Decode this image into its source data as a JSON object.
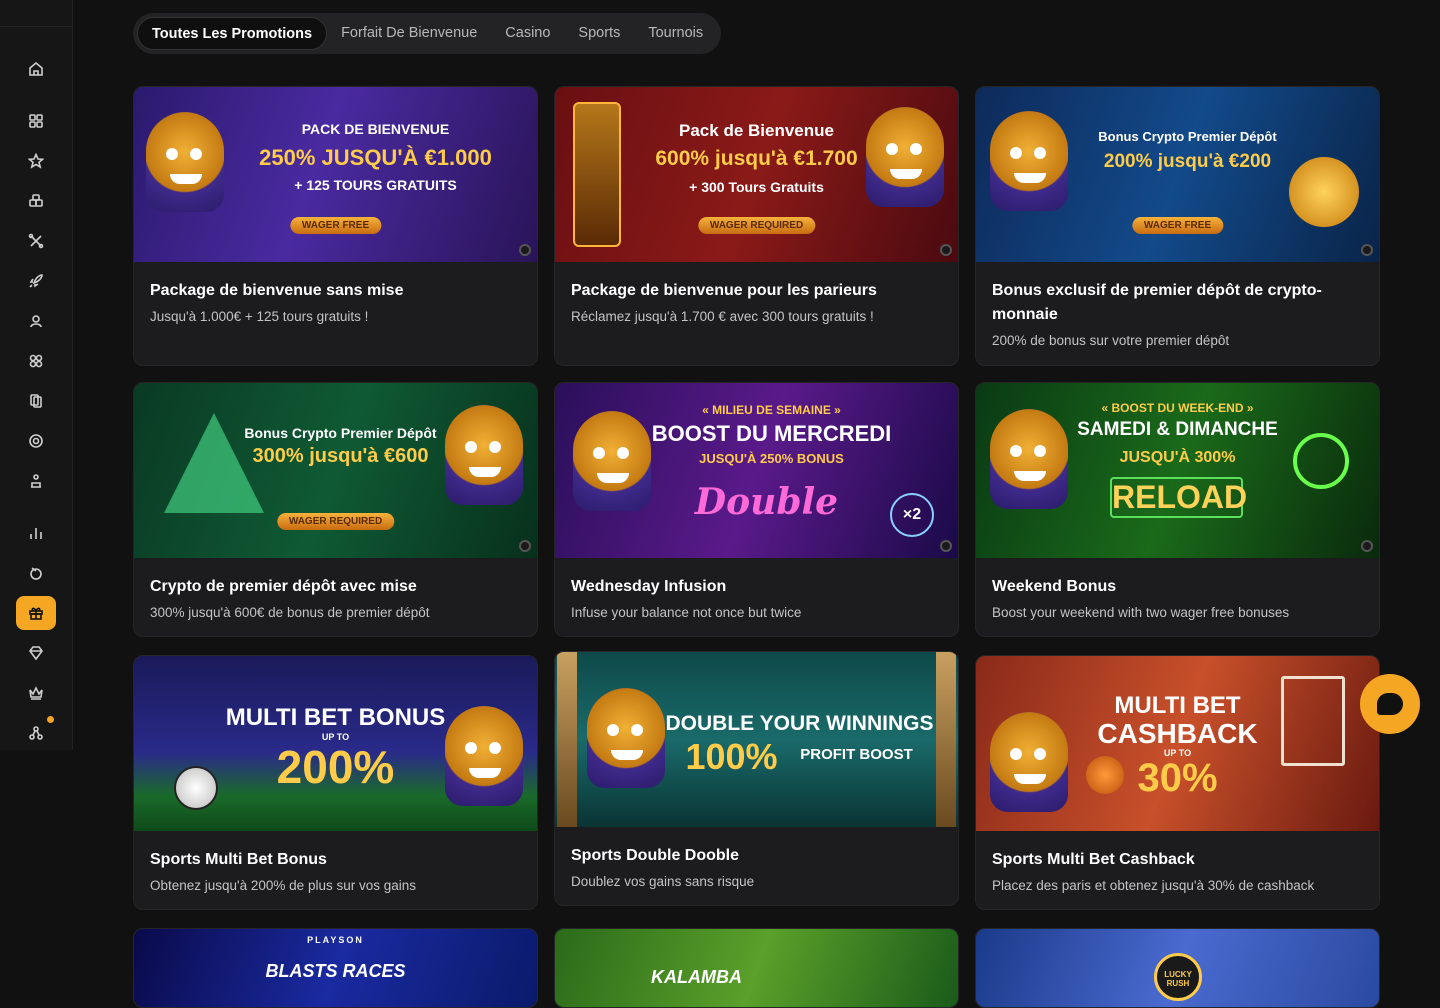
{
  "nav_tabs": [
    {
      "label": "Toutes Les Promotions",
      "active": true
    },
    {
      "label": "Forfait De Bienvenue",
      "active": false
    },
    {
      "label": "Casino",
      "active": false
    },
    {
      "label": "Sports",
      "active": false
    },
    {
      "label": "Tournois",
      "active": false
    }
  ],
  "sidebar_icons": [
    "home-icon",
    "grid-icon",
    "star-icon",
    "dice-icon",
    "cross-icon",
    "rocket-icon",
    "dealer-icon",
    "puzzle-icon",
    "cards-icon",
    "roulette-icon",
    "podium-icon",
    "stats-icon",
    "sports-ball-icon",
    "gift-icon",
    "diamond-icon",
    "crown-icon",
    "network-icon"
  ],
  "colors": {
    "accent": "#f5a623",
    "background": "#111112",
    "card": "#1c1c1e"
  },
  "promos": [
    {
      "title": "Package de bienvenue sans mise",
      "subtitle": "Jusqu'à 1.000€ + 125 tours gratuits !",
      "banner": {
        "line1": "PACK DE BIENVENUE",
        "line2": "250% JUSQU'À €1.000",
        "line3": "+ 125 TOURS GRATUITS",
        "badge": "WAGER FREE"
      }
    },
    {
      "title": "Package de bienvenue pour les parieurs",
      "subtitle": "Réclamez jusqu'à 1.700 € avec 300 tours gratuits !",
      "banner": {
        "line1": "Pack de Bienvenue",
        "line2": "600% jusqu'à €1.700",
        "line3": "+ 300 Tours Gratuits",
        "badge": "WAGER REQUIRED"
      }
    },
    {
      "title": "Bonus exclusif de premier dépôt de crypto-monnaie",
      "subtitle": "200% de bonus sur votre premier dépôt",
      "banner": {
        "line1": "Bonus Crypto Premier Dépôt",
        "line2": "200% jusqu'à €200",
        "line3": "",
        "badge": "WAGER FREE"
      }
    },
    {
      "title": "Crypto de premier dépôt avec mise",
      "subtitle": "300% jusqu'à 600€ de bonus de premier dépôt",
      "banner": {
        "line1": "Bonus Crypto Premier Dépôt",
        "line2": "300% jusqu'à €600",
        "line3": "",
        "badge": "WAGER REQUIRED"
      }
    },
    {
      "title": "Wednesday Infusion",
      "subtitle": "Infuse your balance not once but twice",
      "banner": {
        "line1": "« MILIEU DE SEMAINE »",
        "line2": "BOOST DU MERCREDI",
        "line3": "JUSQU'À 250% BONUS",
        "badge": "Double"
      }
    },
    {
      "title": "Weekend Bonus",
      "subtitle": "Boost your weekend with two wager free bonuses",
      "banner": {
        "line1": "« BOOST DU WEEK-END »",
        "line2": "SAMEDI & DIMANCHE",
        "line3": "JUSQU'À 300%",
        "badge": "RELOAD"
      }
    },
    {
      "title": "Sports Multi Bet Bonus",
      "subtitle": "Obtenez jusqu'à 200% de plus sur vos gains",
      "banner": {
        "line1": "MULTI BET BONUS",
        "line2": "UP TO",
        "line3": "200%",
        "badge": ""
      }
    },
    {
      "title": "Sports Double Dooble",
      "subtitle": "Doublez vos gains sans risque",
      "banner": {
        "line1": "DOUBLE YOUR WINNINGS",
        "line2": "100%",
        "line3": "PROFIT BOOST",
        "badge": ""
      }
    },
    {
      "title": "Sports Multi Bet Cashback",
      "subtitle": "Placez des paris et obtenez jusqu'à 30% de cashback",
      "banner": {
        "line1": "MULTI BET",
        "line2": "CASHBACK",
        "line3": "30%",
        "badge": "UP TO"
      }
    }
  ],
  "bottom_banners": [
    {
      "line1": "PLAYSON",
      "line2": "BLASTS RACES"
    },
    {
      "line1": "KALAMBA",
      "line2": ""
    },
    {
      "line1": "LUCKY RUSH",
      "line2": ""
    }
  ]
}
